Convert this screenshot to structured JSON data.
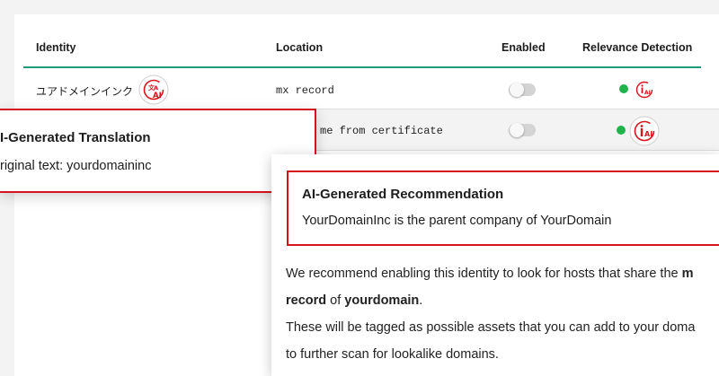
{
  "table": {
    "headers": {
      "identity": "Identity",
      "location": "Location",
      "enabled": "Enabled",
      "relevance": "Relevance Detection"
    },
    "rows": [
      {
        "identity": "ユアドメインインク",
        "location": "mx record",
        "enabled": false,
        "relevance_status": "green"
      },
      {
        "identity": "",
        "location": "me from certificate",
        "enabled": false,
        "relevance_status": "green"
      }
    ]
  },
  "translation_popup": {
    "title": "I-Generated Translation",
    "original_text": "riginal text: yourdomaininc"
  },
  "recommendation_popup": {
    "title": "AI-Generated Recommendation",
    "body": "YourDomainInc is the parent company of YourDomain",
    "para1": {
      "t1": "We recommend enabling this identity to look for hosts that share the ",
      "b1": "m",
      "b2": "record",
      "t2": " of ",
      "b3": "yourdomain",
      "t3": "."
    },
    "para2": {
      "line1": "These will be tagged as possible assets that you can add to your doma",
      "line2": "to further scan for lookalike domains."
    }
  },
  "colors": {
    "accent_teal": "#1f9b7a",
    "highlight_red": "#d6141c",
    "status_green": "#1eb34b"
  },
  "icons": [
    "translate-ai-icon",
    "info-ai-icon"
  ]
}
